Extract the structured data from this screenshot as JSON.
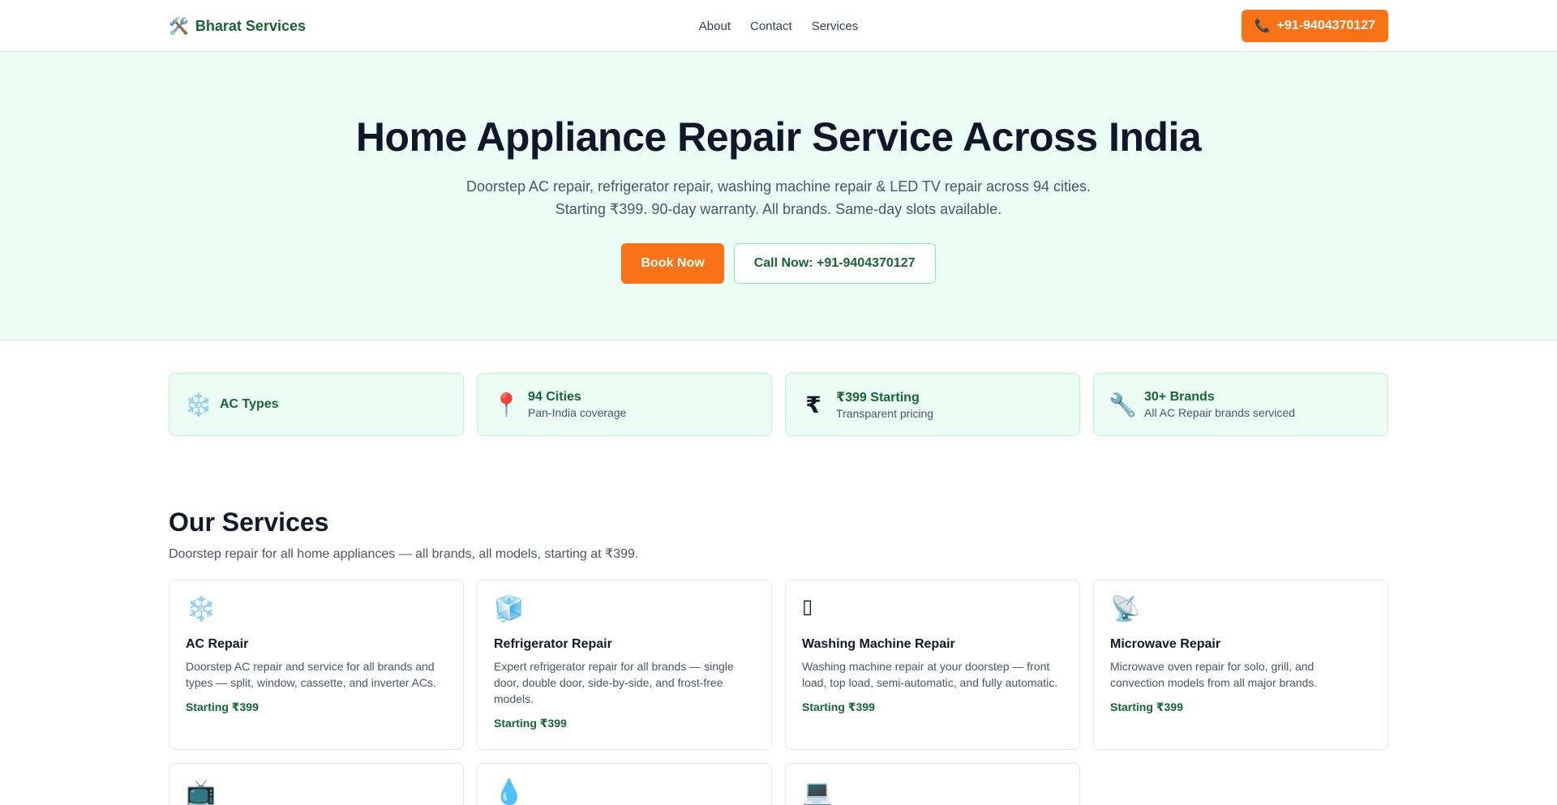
{
  "header": {
    "brand": "Bharat Services",
    "brand_icon": "tools-icon",
    "nav": [
      {
        "label": "About"
      },
      {
        "label": "Contact"
      },
      {
        "label": "Services"
      }
    ],
    "phone_label": "+91-9404370127",
    "phone_icon": "phone-icon"
  },
  "hero": {
    "title": "Home Appliance Repair Service Across India",
    "subtitle": "Doorstep AC repair, refrigerator repair, washing machine repair & LED TV repair across 94 cities. Starting ₹399. 90-day warranty. All brands. Same-day slots available.",
    "book_label": "Book Now",
    "call_label": "Call Now: +91-9404370127"
  },
  "stats": [
    {
      "icon": "snowflake-icon",
      "glyph": "❄️",
      "title": "AC Types",
      "desc": ""
    },
    {
      "icon": "location-pin-icon",
      "glyph": "📍",
      "title": "94 Cities",
      "desc": "Pan-India coverage"
    },
    {
      "icon": "rupee-icon",
      "glyph": "₹",
      "title": "₹399 Starting",
      "desc": "Transparent pricing"
    },
    {
      "icon": "wrench-icon",
      "glyph": "🔧",
      "title": "30+ Brands",
      "desc": "All AC Repair brands serviced"
    }
  ],
  "services": {
    "title": "Our Services",
    "lead": "Doorstep repair for all home appliances — all brands, all models, starting at ₹399.",
    "cards": [
      {
        "icon": "snowflake-icon",
        "glyph": "❄️",
        "title": "AC Repair",
        "desc": "Doorstep AC repair and service for all brands and types — split, window, cassette, and inverter ACs.",
        "price": "Starting ₹399"
      },
      {
        "icon": "ice-cube-icon",
        "glyph": "🧊",
        "title": "Refrigerator Repair",
        "desc": "Expert refrigerator repair for all brands — single door, double door, side-by-side, and frost-free models.",
        "price": "Starting ₹399"
      },
      {
        "icon": "washing-machine-icon",
        "glyph": "▯",
        "title": "Washing Machine Repair",
        "desc": "Washing machine repair at your doorstep — front load, top load, semi-automatic, and fully automatic.",
        "price": "Starting ₹399"
      },
      {
        "icon": "satellite-dish-icon",
        "glyph": "📡",
        "title": "Microwave Repair",
        "desc": "Microwave oven repair for solo, grill, and convection models from all major brands.",
        "price": "Starting ₹399"
      }
    ],
    "more": [
      {
        "icon": "television-icon",
        "glyph": "📺"
      },
      {
        "icon": "water-drop-icon",
        "glyph": "💧"
      },
      {
        "icon": "laptop-icon",
        "glyph": "💻"
      }
    ]
  }
}
